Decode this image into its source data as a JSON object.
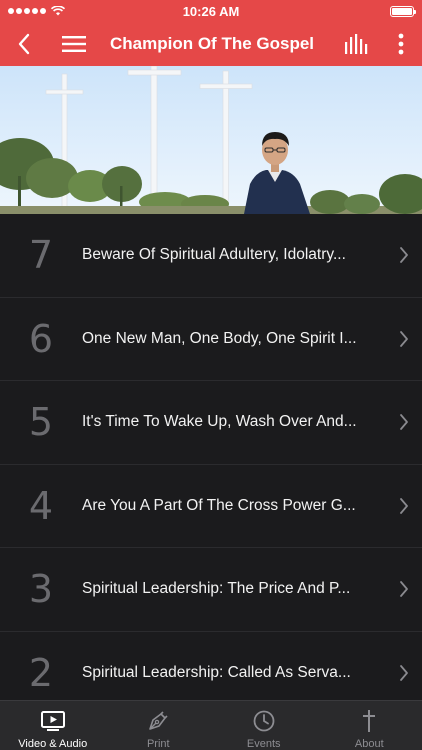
{
  "status_bar": {
    "time": "10:26 AM"
  },
  "nav": {
    "title": "Champion Of The Gospel",
    "back_icon": "chevron-left-icon",
    "menu_icon": "hamburger-icon",
    "stats_icon": "equalizer-icon",
    "more_icon": "more-vertical-icon"
  },
  "colors": {
    "accent": "#e54848",
    "list_bg": "#1b1b1d",
    "tab_bg": "#2a2a2c"
  },
  "episodes": [
    {
      "number": "7",
      "title": "Beware Of Spiritual Adultery, Idolatry..."
    },
    {
      "number": "6",
      "title": "One New Man, One Body, One Spirit I..."
    },
    {
      "number": "5",
      "title": "It's Time To Wake Up, Wash Over And..."
    },
    {
      "number": "4",
      "title": "Are You A Part Of The Cross Power G..."
    },
    {
      "number": "3",
      "title": "Spiritual Leadership: The Price And P..."
    },
    {
      "number": "2",
      "title": "Spiritual Leadership: Called As Serva..."
    }
  ],
  "tabs": [
    {
      "label": "Video & Audio",
      "icon": "video-icon",
      "active": true
    },
    {
      "label": "Print",
      "icon": "pen-nib-icon",
      "active": false
    },
    {
      "label": "Events",
      "icon": "clock-icon",
      "active": false
    },
    {
      "label": "About",
      "icon": "cross-icon",
      "active": false
    }
  ]
}
